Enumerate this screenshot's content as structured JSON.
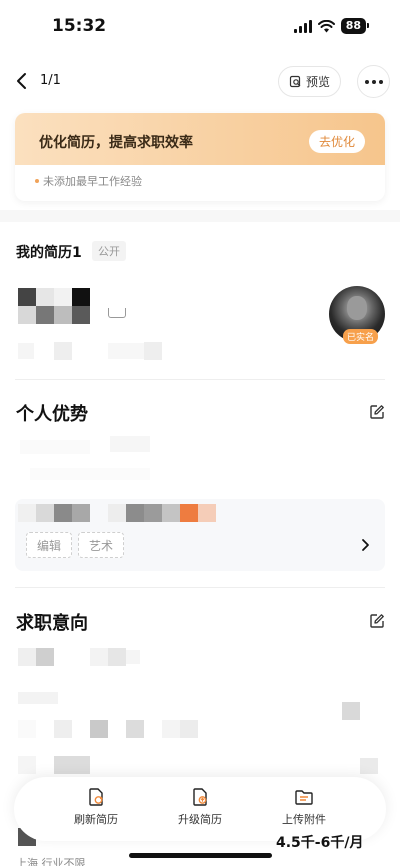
{
  "status_bar": {
    "time": "15:32",
    "battery": "88"
  },
  "nav": {
    "page_counter": "1/1",
    "preview_label": "预览"
  },
  "optimize_card": {
    "title": "优化简历，提高求职效率",
    "button": "去优化",
    "hint": "未添加最早工作经验"
  },
  "resume": {
    "title": "我的简历1",
    "visibility_tag": "公开",
    "verified_badge": "已实名"
  },
  "advantages": {
    "title": "个人优势",
    "tags": [
      "编辑",
      "艺术"
    ]
  },
  "intentions": {
    "title": "求职意向",
    "salary": "4.5千-6千/月",
    "location": "上海  行业不限"
  },
  "bottom_bar": {
    "items": [
      {
        "label": "刷新简历",
        "icon": "refresh-resume-icon"
      },
      {
        "label": "升级简历",
        "icon": "upgrade-resume-icon"
      },
      {
        "label": "上传附件",
        "icon": "upload-attachment-icon"
      }
    ]
  },
  "colors": {
    "accent_orange": "#f0893a",
    "gradient_start": "#fbe0bf",
    "gradient_end": "#f6c58c"
  }
}
